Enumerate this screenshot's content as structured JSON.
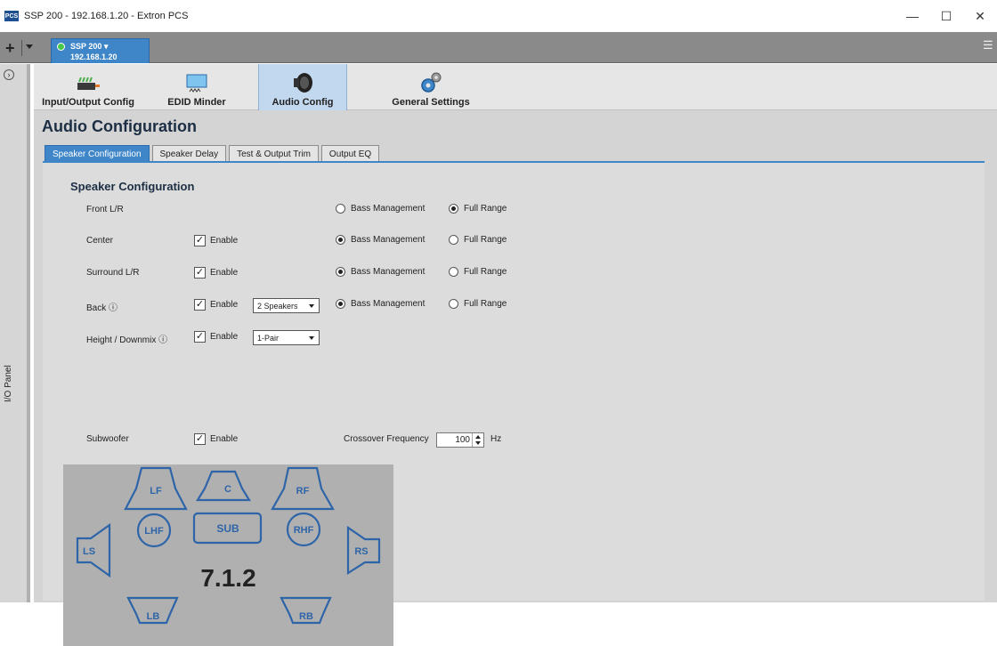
{
  "window": {
    "title": "SSP 200 - 192.168.1.20 - Extron PCS",
    "app_icon": "PCS",
    "minimize": "—",
    "maximize": "☐",
    "close": "✕"
  },
  "device_tab": {
    "name": "SSP 200 ▾",
    "ip": "192.168.1.20",
    "status_color": "#49c94a"
  },
  "side_panel": {
    "label": "I/O Panel"
  },
  "toolbar": {
    "items": [
      {
        "label": "Input/Output Config",
        "icon": "device-icon"
      },
      {
        "label": "EDID Minder",
        "icon": "monitor-icon"
      },
      {
        "label": "Audio Config",
        "icon": "speaker-icon"
      },
      {
        "label": "General Settings",
        "icon": "gears-icon"
      }
    ],
    "active": "Audio Config"
  },
  "page_title": "Audio Configuration",
  "tabs": [
    "Speaker Configuration",
    "Speaker Delay",
    "Test & Output Trim",
    "Output EQ"
  ],
  "active_tab": "Speaker Configuration",
  "section_title": "Speaker Configuration",
  "enable_label": "Enable",
  "bass_label": "Bass Management",
  "full_label": "Full Range",
  "rows": {
    "front": {
      "label": "Front L/R",
      "mode": "Full Range"
    },
    "center": {
      "label": "Center",
      "enabled": true,
      "mode": "Bass Management"
    },
    "surround": {
      "label": "Surround L/R",
      "enabled": true,
      "mode": "Bass Management"
    },
    "back": {
      "label": "Back ⓘ",
      "enabled": true,
      "speakers": "2 Speakers",
      "mode": "Bass Management"
    },
    "height": {
      "label": "Height / Downmix ⓘ",
      "enabled": true,
      "pairs": "1-Pair"
    },
    "subwoofer": {
      "label": "Subwoofer",
      "enabled": true,
      "crossover_label": "Crossover Frequency",
      "crossover_value": "100",
      "crossover_unit": "Hz"
    }
  },
  "diagram": {
    "layout": "7.1.2",
    "speakers": {
      "lf": "LF",
      "c": "C",
      "rf": "RF",
      "lhf": "LHF",
      "sub": "SUB",
      "rhf": "RHF",
      "ls": "LS",
      "rs": "RS",
      "lb": "LB",
      "rb": "RB"
    },
    "stroke_color": "#2e64a8"
  }
}
